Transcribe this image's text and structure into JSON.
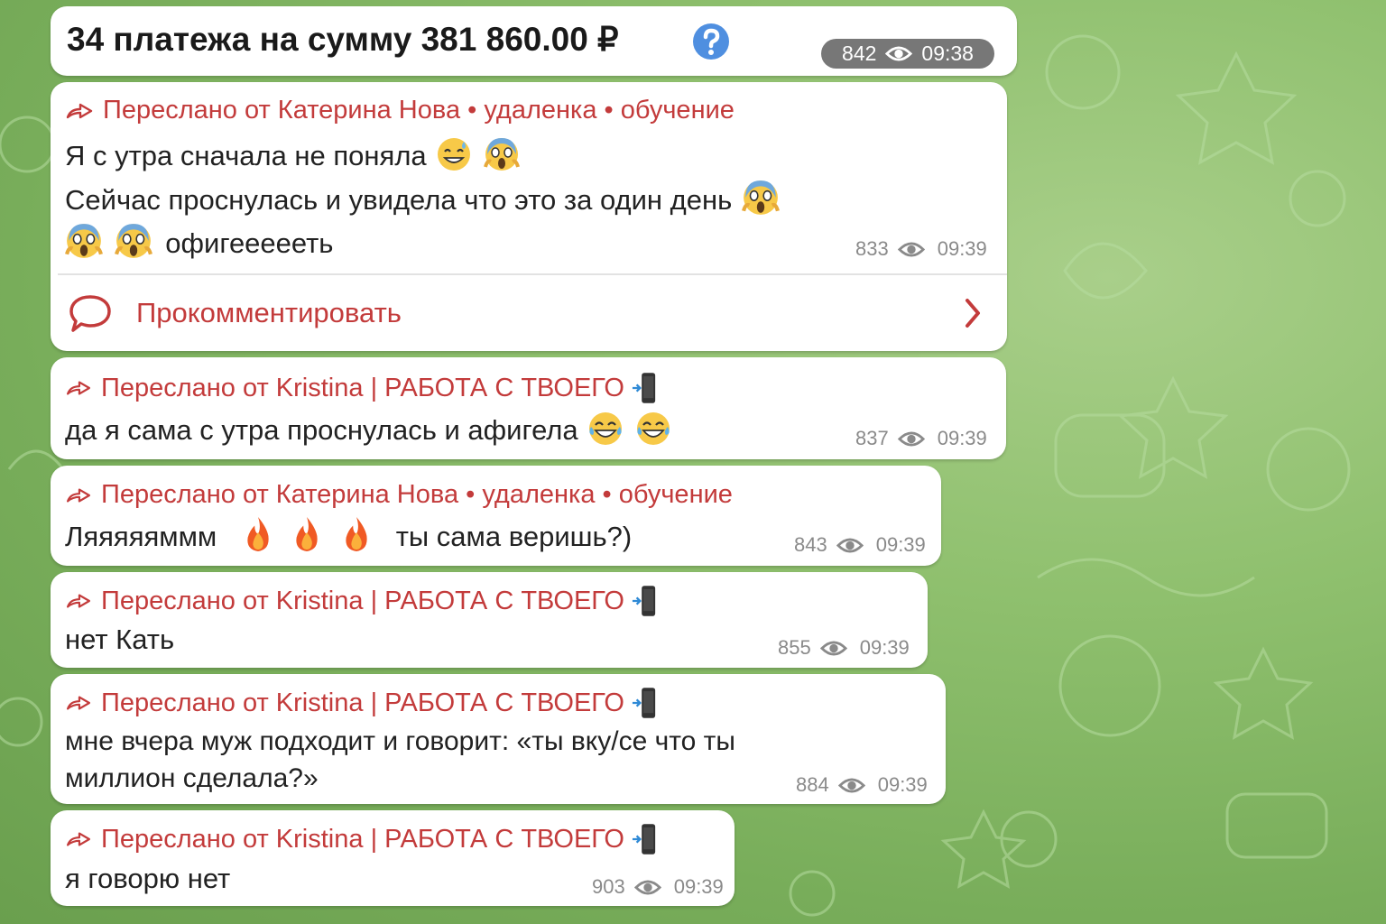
{
  "colors": {
    "forward_text": "#c33b3b",
    "bubble": "#ffffff",
    "meta_text": "#8a8a8a",
    "badge_bg": "#777777",
    "help_icon": "#4f8fe0"
  },
  "header": {
    "title": "34 платежа на сумму 381 860.00 ₽",
    "views": "842",
    "time": "09:38"
  },
  "messages": [
    {
      "forwarded": "Переслано от Катерина Нова • удаленка • обучение",
      "line1": "Я с утра сначала не поняла",
      "line2": "Сейчас проснулась и увидела что это за один день",
      "line3": "офигеееееть",
      "views": "833",
      "time": "09:39",
      "comment_label": "Прокомментировать"
    },
    {
      "forwarded": "Переслано от Kristina | РАБОТА С ТВОЕГО",
      "line1": "да я сама с утра проснулась и афигела",
      "views": "837",
      "time": "09:39"
    },
    {
      "forwarded": "Переслано от Катерина Нова • удаленка • обучение",
      "line1": "Ляяяяяммм",
      "line1b": "ты сама веришь?)",
      "views": "843",
      "time": "09:39"
    },
    {
      "forwarded": "Переслано от Kristina | РАБОТА С ТВОЕГО",
      "line1": "нет Кать",
      "views": "855",
      "time": "09:39"
    },
    {
      "forwarded": "Переслано от Kristina | РАБОТА С ТВОЕГО",
      "line1": "мне вчера муж подходит и говорит: «ты вку/се что ты",
      "line2": "миллион сделала?»",
      "views": "884",
      "time": "09:39"
    },
    {
      "forwarded": "Переслано от Kristina | РАБОТА С ТВОЕГО",
      "line1": "я говорю нет",
      "views": "903",
      "time": "09:39"
    }
  ],
  "icons": [
    "forward-arrow-icon",
    "eye-icon",
    "comment-bubble-icon",
    "chevron-right-icon",
    "help-icon",
    "mobile-phone-arrow-icon"
  ]
}
